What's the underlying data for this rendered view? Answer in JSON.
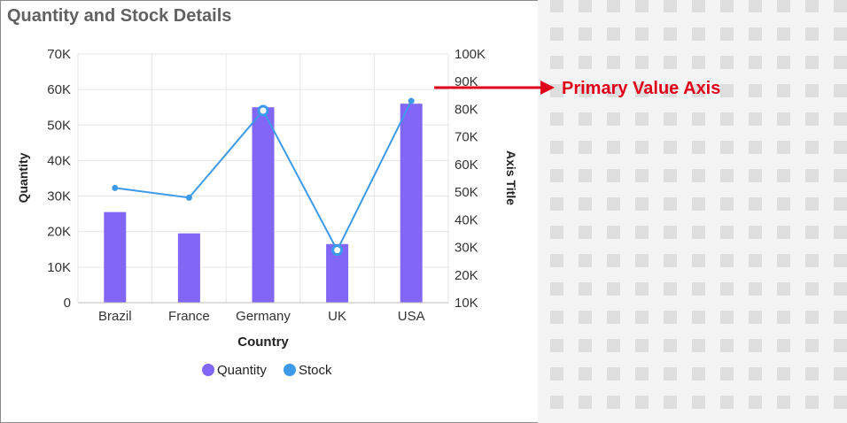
{
  "card": {
    "title": "Quantity and Stock Details"
  },
  "annotation": {
    "label": "Primary Value Axis",
    "color": "#e0001a"
  },
  "colors": {
    "quantity": "#8266f5",
    "stock": "#3d9ae8",
    "grid": "#e6e6e6",
    "text": "#333333",
    "pattern_bg": "#f4f4f4",
    "pattern_cell": "#dedede"
  },
  "chart_data": {
    "type": "bar",
    "categories": [
      "Brazil",
      "France",
      "Germany",
      "UK",
      "USA"
    ],
    "xlabel": "Country",
    "ylabel": "Quantity",
    "ylabel_secondary": "Axis Title",
    "ylim": [
      0,
      70000
    ],
    "ylim_secondary": [
      10000,
      100000
    ],
    "yticks": [
      "0",
      "10K",
      "20K",
      "30K",
      "40K",
      "50K",
      "60K",
      "70K"
    ],
    "yticks_secondary": [
      "10K",
      "20K",
      "30K",
      "40K",
      "50K",
      "60K",
      "70K",
      "80K",
      "90K",
      "100K"
    ],
    "grid": true,
    "legend_position": "bottom",
    "series": [
      {
        "name": "Quantity",
        "type": "bar",
        "axis": "primary",
        "values": [
          25500,
          19500,
          55000,
          16500,
          56000
        ]
      },
      {
        "name": "Stock",
        "type": "line",
        "axis": "secondary",
        "values": [
          51500,
          48000,
          79500,
          29000,
          83000
        ]
      }
    ]
  }
}
